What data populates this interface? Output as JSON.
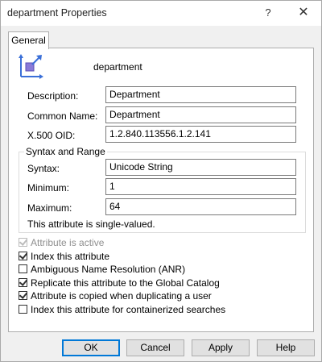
{
  "window": {
    "title": "department Properties",
    "help_glyph": "?",
    "close_glyph": "✕"
  },
  "tabs": [
    {
      "label": "General",
      "selected": true
    }
  ],
  "attribute": {
    "name": "department",
    "icon": "attribute-icon"
  },
  "fields": {
    "description": {
      "label": "Description:",
      "value": "Department"
    },
    "common_name": {
      "label": "Common Name:",
      "value": "Department"
    },
    "oid": {
      "label": "X.500 OID:",
      "value": "1.2.840.113556.1.2.141"
    }
  },
  "syntax_range": {
    "legend": "Syntax and Range",
    "syntax": {
      "label": "Syntax:",
      "value": "Unicode String"
    },
    "minimum": {
      "label": "Minimum:",
      "value": "1"
    },
    "maximum": {
      "label": "Maximum:",
      "value": "64"
    },
    "note": "This attribute is single-valued."
  },
  "options": [
    {
      "label": "Attribute is active",
      "checked": true,
      "disabled": true
    },
    {
      "label": "Index this attribute",
      "checked": true,
      "disabled": false
    },
    {
      "label": "Ambiguous Name Resolution (ANR)",
      "checked": false,
      "disabled": false
    },
    {
      "label": "Replicate this attribute to the Global Catalog",
      "checked": true,
      "disabled": false
    },
    {
      "label": "Attribute is copied when duplicating a user",
      "checked": true,
      "disabled": false
    },
    {
      "label": "Index this attribute for containerized searches",
      "checked": false,
      "disabled": false
    }
  ],
  "buttons": {
    "ok": "OK",
    "cancel": "Cancel",
    "apply": "Apply",
    "help": "Help"
  },
  "colors": {
    "icon_blue": "#3a6fd8",
    "icon_purple": "#8a7ad8",
    "default_button_border": "#0078d7"
  }
}
